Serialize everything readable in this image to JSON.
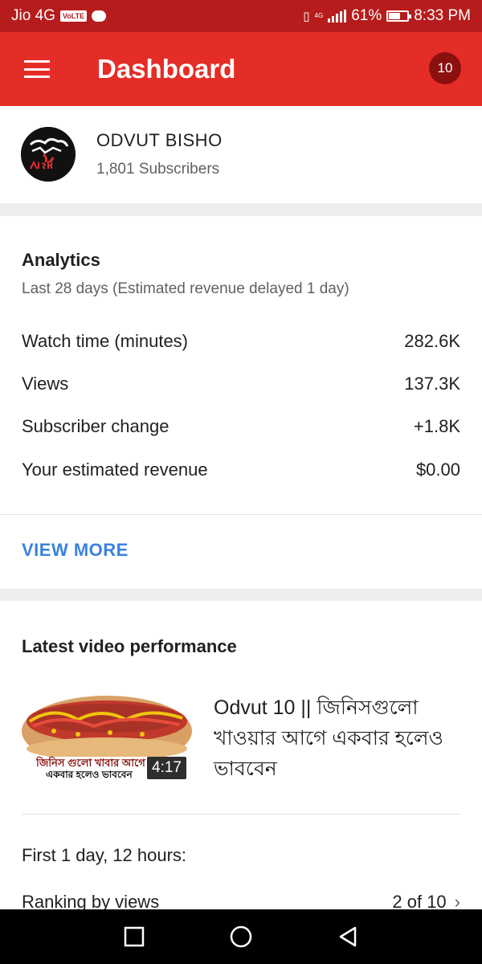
{
  "status_bar": {
    "carrier": "Jio 4G",
    "volte": "VoLTE",
    "network": "4G",
    "battery": "61%",
    "battery_level": 0.61,
    "time": "8:33 PM"
  },
  "app_bar": {
    "title": "Dashboard",
    "notification_count": "10"
  },
  "channel": {
    "name": "ODVUT BISHO",
    "subscribers": "1,801 Subscribers"
  },
  "analytics": {
    "title": "Analytics",
    "subtitle": "Last 28 days (Estimated revenue delayed 1 day)",
    "metrics": [
      {
        "label": "Watch time (minutes)",
        "value": "282.6K"
      },
      {
        "label": "Views",
        "value": "137.3K"
      },
      {
        "label": "Subscriber change",
        "value": "+1.8K"
      },
      {
        "label": "Your estimated revenue",
        "value": "$0.00"
      }
    ],
    "view_more": "VIEW MORE"
  },
  "latest_video": {
    "section_title": "Latest video performance",
    "title": "Odvut 10 || জিনিসগুলো খাওয়ার আগে একবার হলেও ভাববেন",
    "thumbnail_caption_line1": "জিনিস গুলো খাবার আগে",
    "thumbnail_caption_line2": "একবার হলেও ভাববেন",
    "duration": "4:17",
    "period": "First 1 day, 12 hours:",
    "ranking_label": "Ranking by views",
    "ranking_value": "2 of 10"
  },
  "colors": {
    "status_bar": "#b71c1c",
    "app_bar": "#e52d27",
    "badge": "#8b1010",
    "link": "#3b82e0"
  },
  "icons": {
    "menu": "hamburger-icon",
    "nav_recent": "square-icon",
    "nav_home": "circle-icon",
    "nav_back": "triangle-back-icon"
  }
}
